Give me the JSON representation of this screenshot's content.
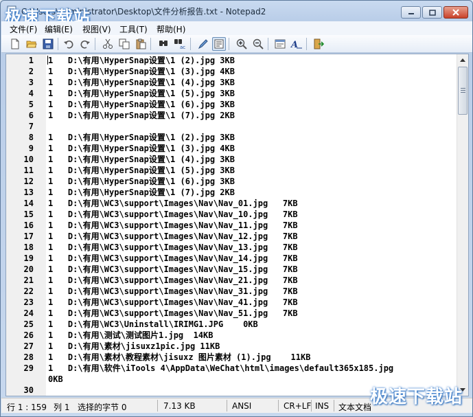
{
  "window": {
    "title": "C:\\Users\\Administrator\\Desktop\\文件分析报告.txt - Notepad2",
    "watermark": "极速下载站"
  },
  "menu": {
    "items": [
      "文件(F)",
      "编辑(E)",
      "视图(V)",
      "工具(T)",
      "帮助(H)"
    ]
  },
  "toolbar": {
    "buttons": [
      "new-icon",
      "open-icon",
      "save-icon",
      "undo-icon",
      "redo-icon",
      "cut-icon",
      "copy-icon",
      "paste-icon",
      "find-icon",
      "replace-icon",
      "wordwrap-icon",
      "zoom-in-icon",
      "zoom-out-icon",
      "scheme-icon",
      "font-icon",
      "exit-icon"
    ]
  },
  "editor": {
    "lines": [
      {
        "n": "1",
        "t": "1   D:\\有用\\HyperSnap设置\\1 (2).jpg 3KB"
      },
      {
        "n": "2",
        "t": "1   D:\\有用\\HyperSnap设置\\1 (3).jpg 4KB"
      },
      {
        "n": "3",
        "t": "1   D:\\有用\\HyperSnap设置\\1 (4).jpg 3KB"
      },
      {
        "n": "4",
        "t": "1   D:\\有用\\HyperSnap设置\\1 (5).jpg 3KB"
      },
      {
        "n": "5",
        "t": "1   D:\\有用\\HyperSnap设置\\1 (6).jpg 3KB"
      },
      {
        "n": "6",
        "t": "1   D:\\有用\\HyperSnap设置\\1 (7).jpg 2KB"
      },
      {
        "n": "7",
        "t": ""
      },
      {
        "n": "8",
        "t": "1   D:\\有用\\HyperSnap设置\\1 (2).jpg 3KB"
      },
      {
        "n": "9",
        "t": "1   D:\\有用\\HyperSnap设置\\1 (3).jpg 4KB"
      },
      {
        "n": "10",
        "t": "1   D:\\有用\\HyperSnap设置\\1 (4).jpg 3KB"
      },
      {
        "n": "11",
        "t": "1   D:\\有用\\HyperSnap设置\\1 (5).jpg 3KB"
      },
      {
        "n": "12",
        "t": "1   D:\\有用\\HyperSnap设置\\1 (6).jpg 3KB"
      },
      {
        "n": "13",
        "t": "1   D:\\有用\\HyperSnap设置\\1 (7).jpg 2KB"
      },
      {
        "n": "14",
        "t": "1   D:\\有用\\WC3\\support\\Images\\Nav\\Nav_01.jpg   7KB"
      },
      {
        "n": "15",
        "t": "1   D:\\有用\\WC3\\support\\Images\\Nav\\Nav_10.jpg   7KB"
      },
      {
        "n": "16",
        "t": "1   D:\\有用\\WC3\\support\\Images\\Nav\\Nav_11.jpg   7KB"
      },
      {
        "n": "17",
        "t": "1   D:\\有用\\WC3\\support\\Images\\Nav\\Nav_12.jpg   7KB"
      },
      {
        "n": "18",
        "t": "1   D:\\有用\\WC3\\support\\Images\\Nav\\Nav_13.jpg   7KB"
      },
      {
        "n": "19",
        "t": "1   D:\\有用\\WC3\\support\\Images\\Nav\\Nav_14.jpg   7KB"
      },
      {
        "n": "20",
        "t": "1   D:\\有用\\WC3\\support\\Images\\Nav\\Nav_15.jpg   7KB"
      },
      {
        "n": "21",
        "t": "1   D:\\有用\\WC3\\support\\Images\\Nav\\Nav_21.jpg   7KB"
      },
      {
        "n": "22",
        "t": "1   D:\\有用\\WC3\\support\\Images\\Nav\\Nav_31.jpg   7KB"
      },
      {
        "n": "23",
        "t": "1   D:\\有用\\WC3\\support\\Images\\Nav\\Nav_41.jpg   7KB"
      },
      {
        "n": "24",
        "t": "1   D:\\有用\\WC3\\support\\Images\\Nav\\Nav_51.jpg   7KB"
      },
      {
        "n": "25",
        "t": "1   D:\\有用\\WC3\\Uninstall\\IRIMG1.JPG    0KB"
      },
      {
        "n": "26",
        "t": "1   D:\\有用\\测试\\测试图片1.jpg  14KB"
      },
      {
        "n": "27",
        "t": "1   D:\\有用\\素材\\jisuxz1pic.jpg 11KB"
      },
      {
        "n": "28",
        "t": "1   D:\\有用\\素材\\教程素材\\jisuxz 图片素材 (1).jpg    11KB"
      },
      {
        "n": "29",
        "t": "1   D:\\有用\\软件\\iTools 4\\AppData\\WeChat\\html\\images\\default365x185.jpg"
      },
      {
        "n": "",
        "t": "0KB"
      },
      {
        "n": "30",
        "t": ""
      }
    ]
  },
  "statusbar": {
    "position": "行 1 : 159",
    "column": "列 1",
    "selection": "选择的字节 0",
    "size": "7.13 KB",
    "encoding": "ANSI",
    "eol": "CR+LF",
    "ins": "INS",
    "scheme": "文本文档"
  }
}
